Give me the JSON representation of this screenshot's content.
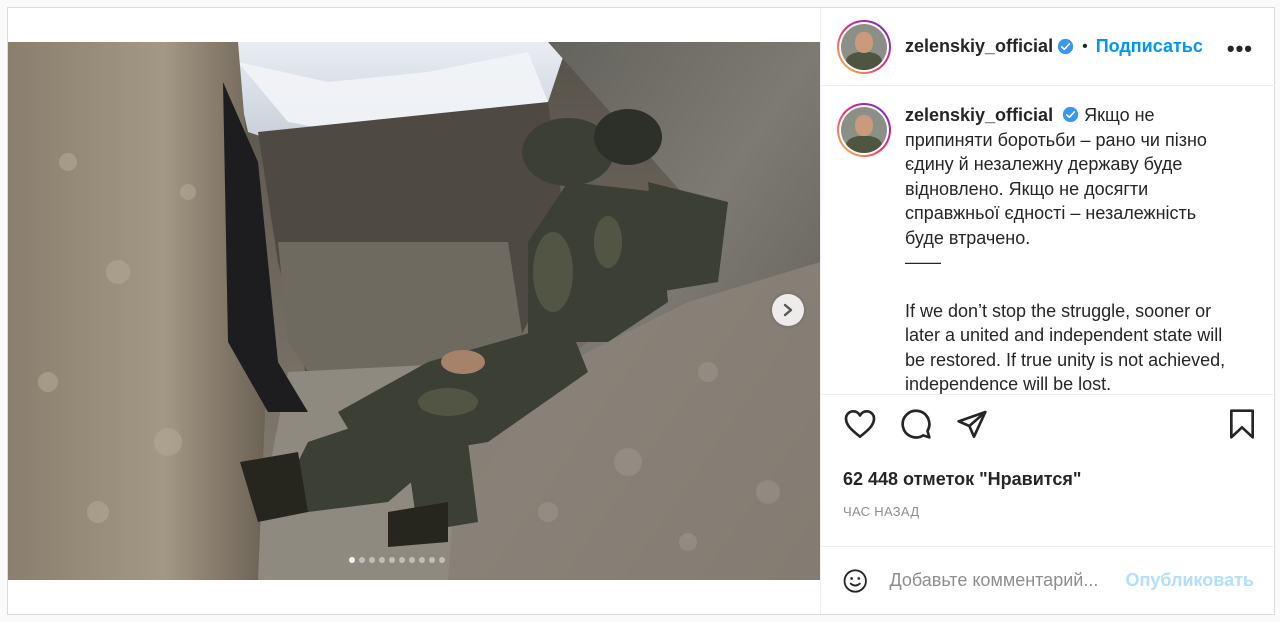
{
  "post": {
    "username": "zelenskiy_official",
    "follow_label": "Подписаться",
    "bullet": "•",
    "more_label": "•••",
    "caption": {
      "username": "zelenskiy_official",
      "paragraph1": "Якщо не припиняти боротьби – рано чи пізно єдину й незалежну державу буде відновлено. Якщо не досягти справжньої єдності – незалежність буде втрачено.",
      "separator": "——",
      "paragraph2": "If we don’t stop the struggle, sooner or later a united and independent state will be restored. If true unity is not achieved, independence will be lost."
    },
    "likes": "62 448 отметок \"Нравится\"",
    "timestamp": "ЧАС НАЗАД",
    "comment_placeholder": "Добавьте комментарий...",
    "publish_label": "Опубликовать",
    "carousel": {
      "count": 10,
      "active_index": 0
    }
  },
  "icons": [
    "verified-badge-icon",
    "heart-icon",
    "comment-icon",
    "share-icon",
    "bookmark-icon",
    "emoji-icon",
    "chevron-right-icon"
  ],
  "colors": {
    "accent": "#0095f6",
    "publish_disabled": "#b2dffc",
    "muted": "#8e8e8e",
    "border": "#dbdbdb"
  }
}
